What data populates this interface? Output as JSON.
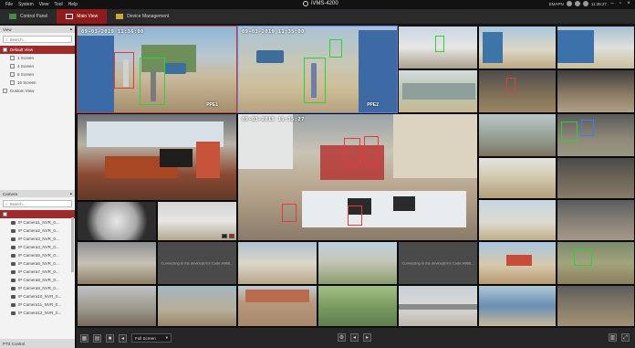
{
  "app": {
    "title": "iVMS-4200",
    "menus": [
      "File",
      "System",
      "View",
      "Tool",
      "Help"
    ],
    "status": {
      "user": "EMAPN",
      "time": "11:35:27"
    }
  },
  "tabs": [
    {
      "label": "Control Panel",
      "icon": "grid-icon",
      "active": false
    },
    {
      "label": "Main View",
      "icon": "monitor-icon",
      "active": true
    },
    {
      "label": "Device Management",
      "icon": "device-icon",
      "active": false
    }
  ],
  "view_panel": {
    "header": "View",
    "search_placeholder": "Search...",
    "items": [
      {
        "label": "Default View",
        "selected": true,
        "indent": 0
      },
      {
        "label": "1 Screen",
        "selected": false,
        "indent": 1
      },
      {
        "label": "4 Screen",
        "selected": false,
        "indent": 1
      },
      {
        "label": "9 Screen",
        "selected": false,
        "indent": 1
      },
      {
        "label": "16 Screen",
        "selected": false,
        "indent": 1
      },
      {
        "label": "Custom View",
        "selected": false,
        "indent": 0
      }
    ]
  },
  "camera_panel": {
    "header": "Camera",
    "search_placeholder": "Search...",
    "group_label": "",
    "cameras": [
      "IP Camera1_NVR_0...",
      "IP Camera2_NVR_0...",
      "IP Camera3_NVR_0...",
      "IP Camera4_NVR_0...",
      "IP Camera5_NVR_0...",
      "IP Camera6_NVR_0...",
      "IP Camera7_NVR_0...",
      "IP Camera8_NVR_0...",
      "IP Camera9_NVR_0...",
      "IP Camera10_NVR_0...",
      "IP Camera11_NVR_0...",
      "IP Camera12_NVR_0..."
    ]
  },
  "ptz": {
    "label": "PTZ Control"
  },
  "tiles": {
    "t1": {
      "osd": "09-03-2019 11:36:00",
      "name": "PPE1"
    },
    "t2": {
      "osd": "09-03-2019 11:35:00",
      "name": "PPE2"
    },
    "t_big": {
      "osd": "09-03-2019 11:35:27"
    },
    "connecting": "Connecting to the device(Error Code:H966..."
  },
  "bottom": {
    "screen_select": "Full Screen"
  },
  "colors": {
    "accent": "#8f1c1c",
    "detection": "#2fd13a",
    "panel_bg": "#f3f3f3"
  }
}
